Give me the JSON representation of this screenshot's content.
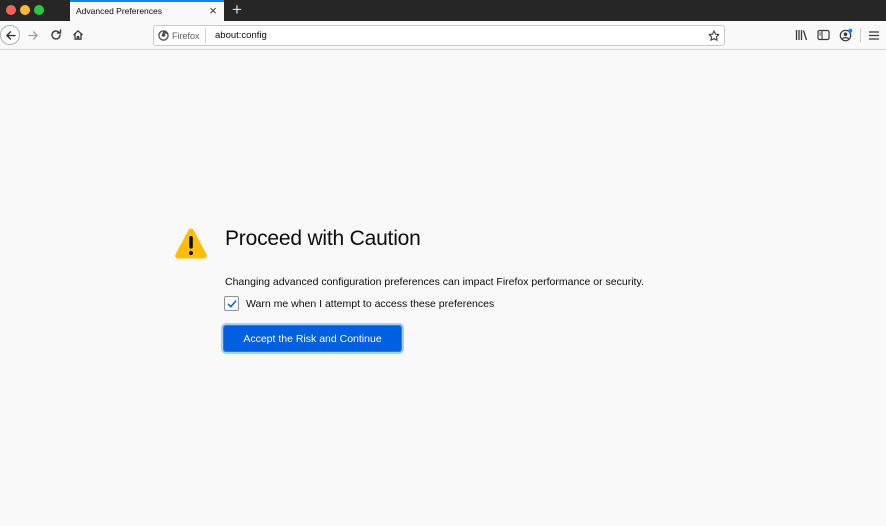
{
  "window": {
    "tab_title": "Advanced Preferences",
    "tab_close": "×",
    "new_tab": "+"
  },
  "navbar": {
    "identity_label": "Firefox",
    "url": "about:config"
  },
  "icons": {
    "back": "back-arrow-icon",
    "forward": "forward-arrow-icon",
    "reload": "reload-icon",
    "home": "home-icon",
    "star": "bookmark-star-icon",
    "library": "library-icon",
    "sidebar": "sidebar-icon",
    "account": "account-icon",
    "menu": "hamburger-menu-icon",
    "warning": "warning-triangle-icon"
  },
  "colors": {
    "accent": "#0060df",
    "warning": "#ffbf00",
    "tabstrip": "#262626"
  },
  "page": {
    "title": "Proceed with Caution",
    "description": "Changing advanced configuration preferences can impact Firefox performance or security.",
    "checkbox_label": "Warn me when I attempt to access these preferences",
    "checkbox_checked": true,
    "accept_button": "Accept the Risk and Continue"
  }
}
